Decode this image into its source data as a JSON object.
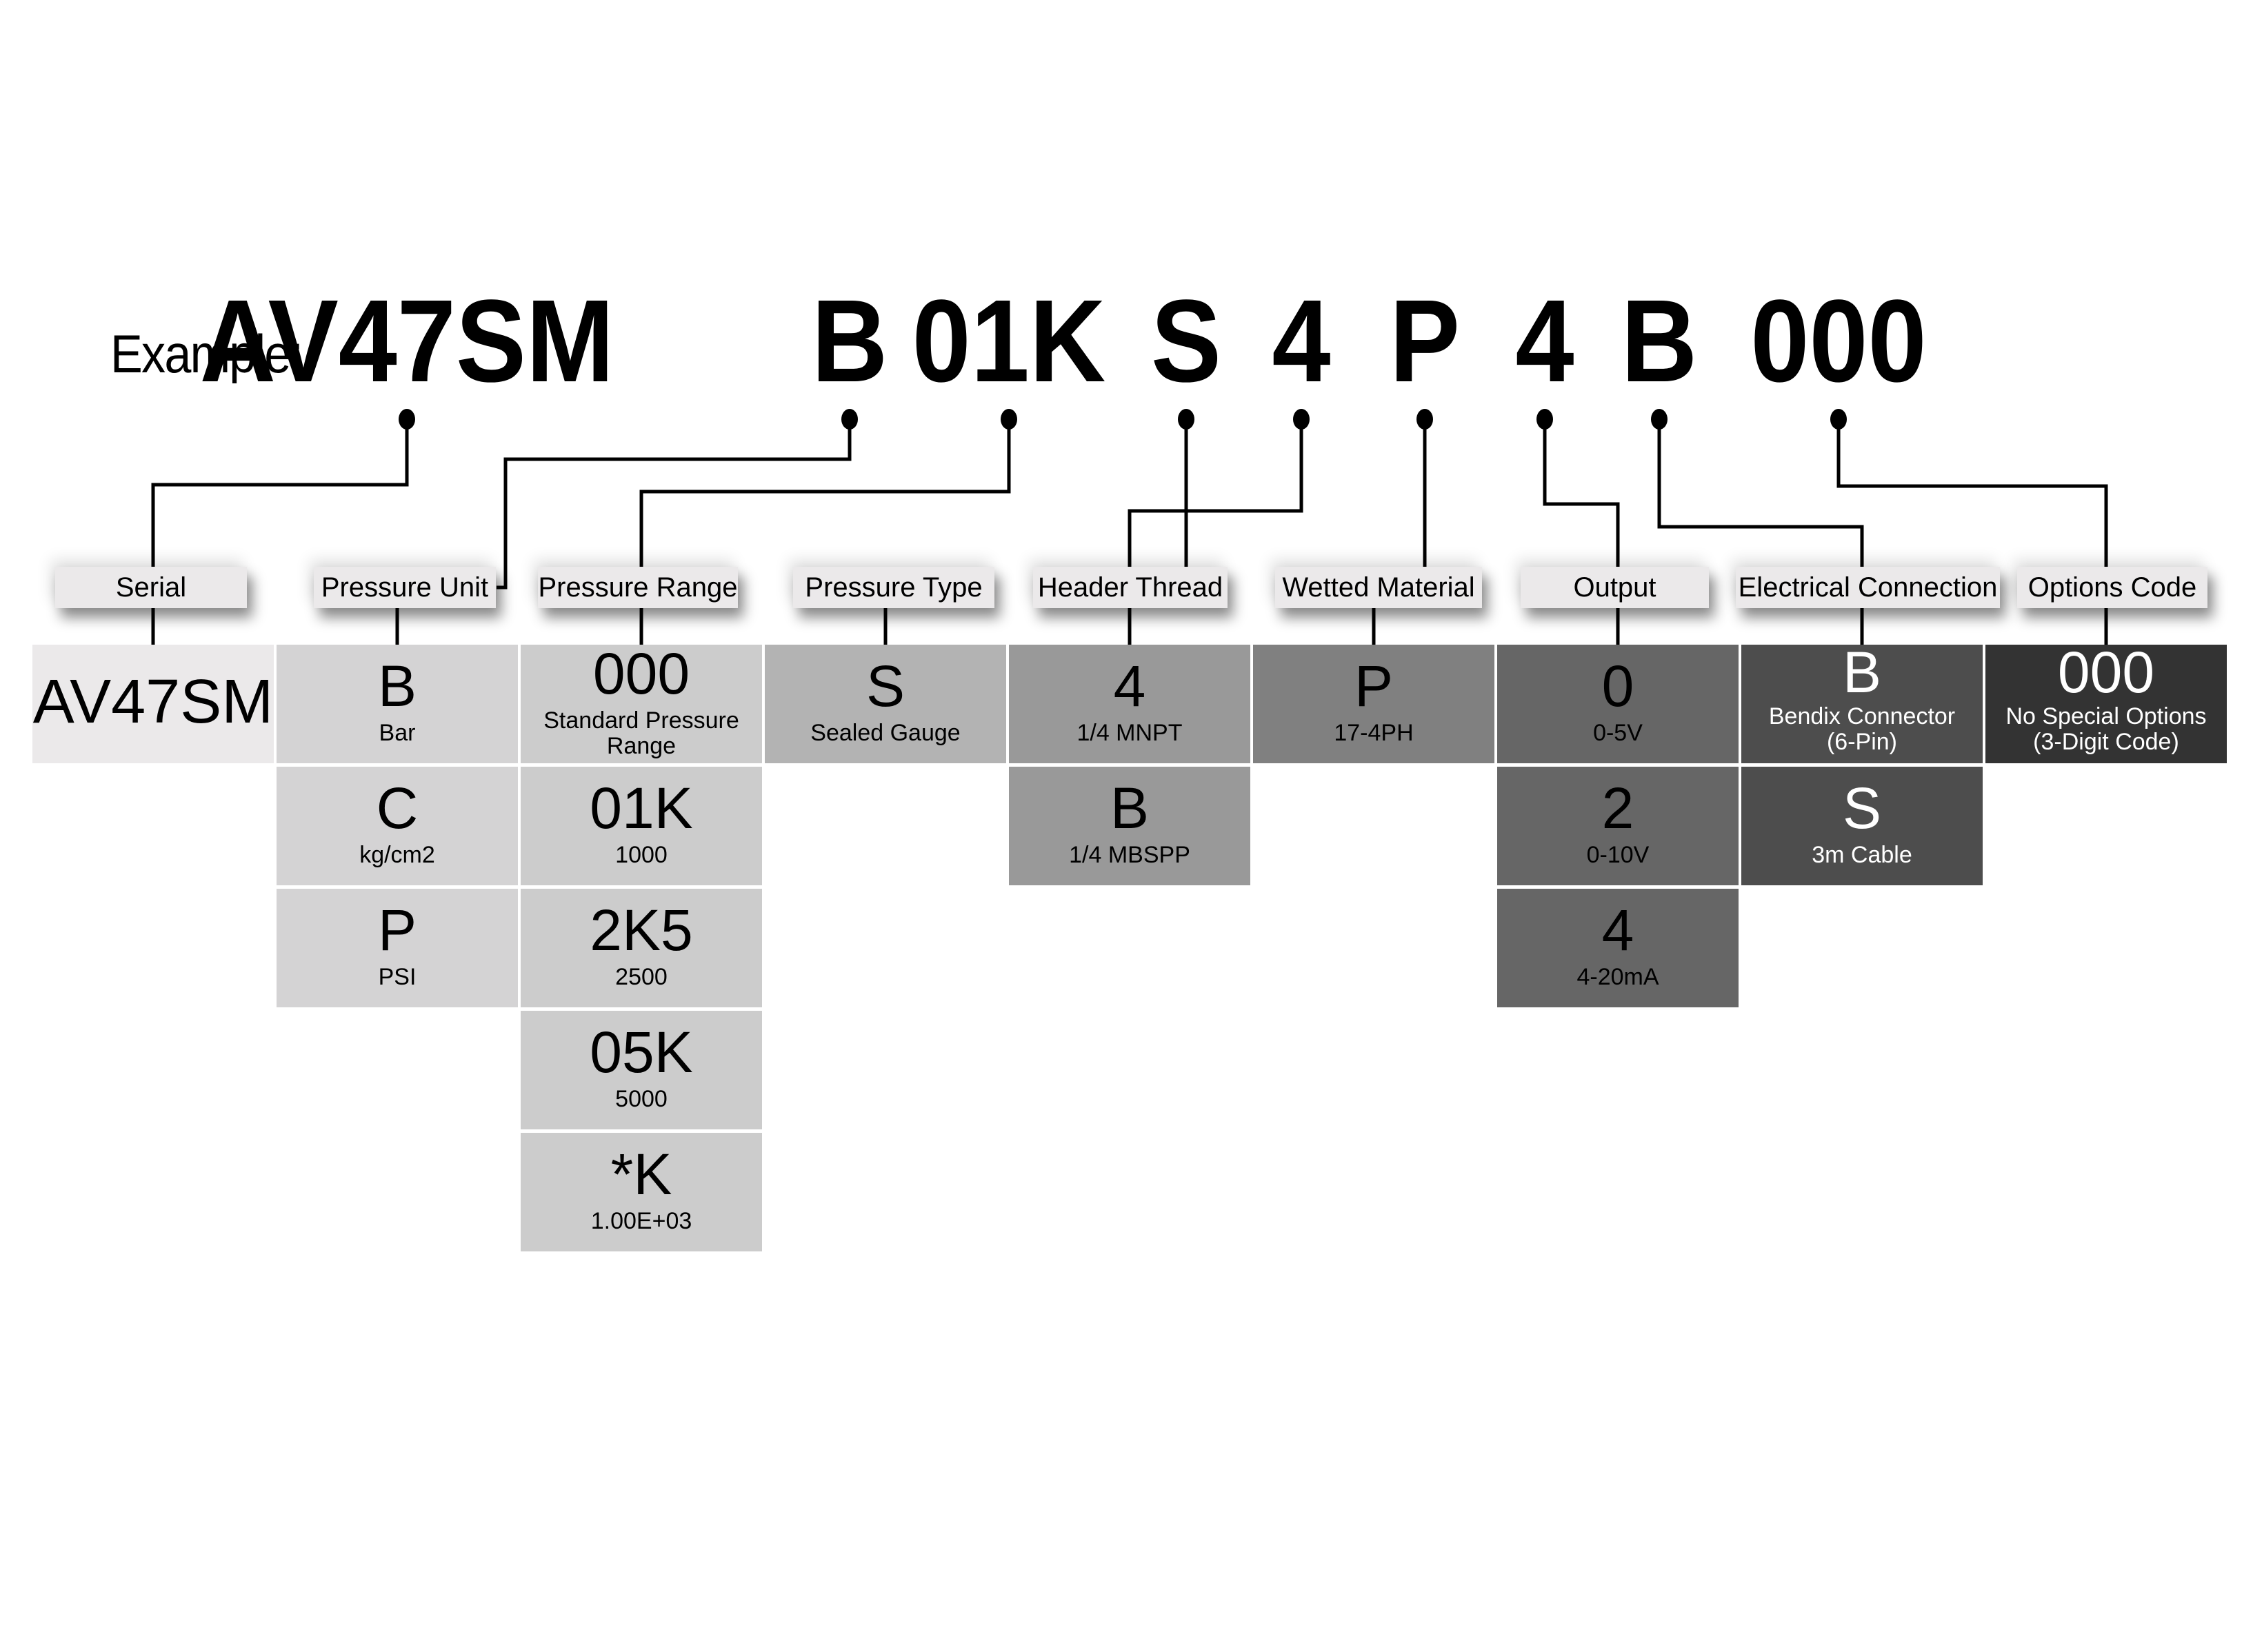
{
  "title": {
    "example_label": "Example:",
    "segments": [
      "AV47SM",
      "B",
      "01K",
      "S",
      "4",
      "P",
      "4",
      "B",
      "000"
    ]
  },
  "columns": [
    {
      "label": "Serial",
      "color": "#ebe9ea",
      "text_color": "#000000",
      "options": [
        {
          "code": "AV47SM",
          "desc": ""
        }
      ]
    },
    {
      "label": "Pressure Unit",
      "color": "#d4d3d4",
      "text_color": "#000000",
      "options": [
        {
          "code": "B",
          "desc": "Bar"
        },
        {
          "code": "C",
          "desc": "kg/cm2"
        },
        {
          "code": "P",
          "desc": "PSI"
        }
      ]
    },
    {
      "label": "Pressure Range",
      "color": "#cccccc",
      "text_color": "#000000",
      "options": [
        {
          "code": "000",
          "desc": "Standard Pressure Range"
        },
        {
          "code": "01K",
          "desc": "1000"
        },
        {
          "code": "2K5",
          "desc": "2500"
        },
        {
          "code": "05K",
          "desc": "5000"
        },
        {
          "code": "*K",
          "desc": "1.00E+03"
        }
      ]
    },
    {
      "label": "Pressure Type",
      "color": "#b3b3b3",
      "text_color": "#000000",
      "options": [
        {
          "code": "S",
          "desc": "Sealed Gauge"
        }
      ]
    },
    {
      "label": "Header Thread",
      "color": "#999999",
      "text_color": "#000000",
      "options": [
        {
          "code": "4",
          "desc": "1/4 MNPT"
        },
        {
          "code": "B",
          "desc": "1/4 MBSPP"
        }
      ]
    },
    {
      "label": "Wetted Material",
      "color": "#808080",
      "text_color": "#000000",
      "options": [
        {
          "code": "P",
          "desc": "17-4PH"
        }
      ]
    },
    {
      "label": "Output",
      "color": "#666666",
      "text_color": "#000000",
      "options": [
        {
          "code": "0",
          "desc": "0-5V"
        },
        {
          "code": "2",
          "desc": "0-10V"
        },
        {
          "code": "4",
          "desc": "4-20mA"
        }
      ]
    },
    {
      "label": "Electrical Connection",
      "color": "#4d4d4d",
      "text_color": "#ffffff",
      "options": [
        {
          "code": "B",
          "desc": "Bendix Connector\n(6-Pin)"
        },
        {
          "code": "S",
          "desc": "3m Cable"
        }
      ]
    },
    {
      "label": "Options Code",
      "color": "#333333",
      "text_color": "#ffffff",
      "options": [
        {
          "code": "000",
          "desc": "No Special Options\n(3-Digit Code)"
        }
      ]
    }
  ]
}
